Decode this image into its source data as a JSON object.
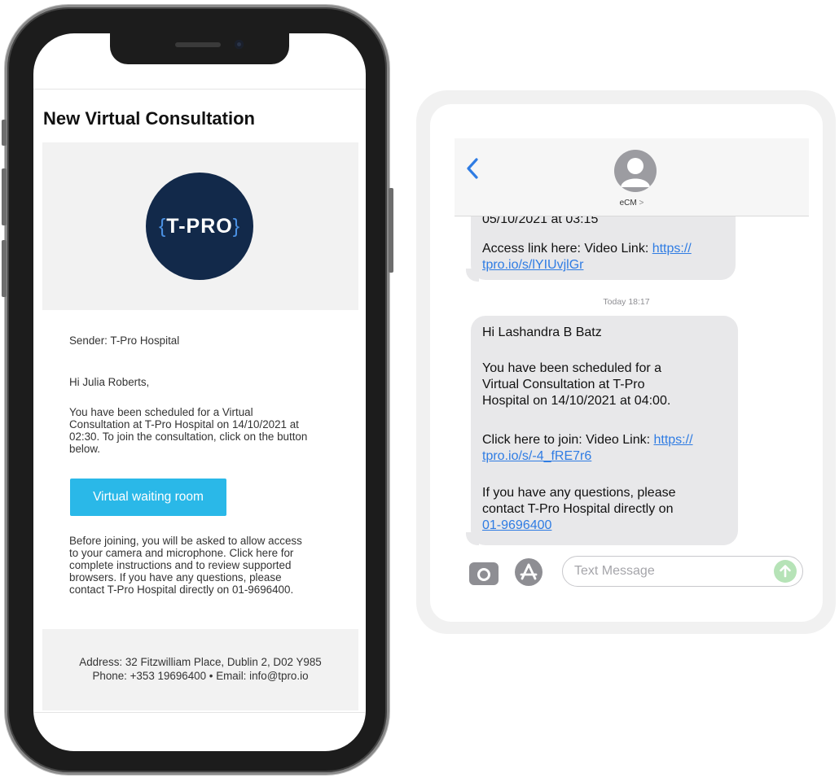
{
  "email": {
    "title": "New Virtual Consultation",
    "logo_text": "T-PRO",
    "sender": "Sender: T-Pro Hospital",
    "greeting": "Hi Julia Roberts,",
    "schedule_lines": [
      "You have been scheduled for a Virtual",
      "Consultation at T-Pro Hospital on 14/10/2021 at",
      "02:30. To join the consultation, click on the button",
      "below."
    ],
    "button_label": "Virtual waiting room",
    "info_lines": [
      "Before joining, you will be asked to allow access",
      "to your camera and microphone. Click here for",
      "complete instructions and to review supported",
      "browsers. If you have any questions, please",
      "contact T-Pro Hospital directly on 01-9696400."
    ],
    "footer_address": "Address: 32 Fitzwilliam Place, Dublin 2, D02 Y985",
    "footer_contact": "Phone: +353 19696400 • Email: info@tpro.io",
    "colors": {
      "button": "#2ab8e8",
      "logo_bg": "#12294a",
      "logo_bracket": "#4a90e2"
    }
  },
  "sms": {
    "back_icon": "chevron-left-icon",
    "contact_name": "eCM",
    "contact_chevron": ">",
    "previous_message": {
      "partial_line": "05/10/2021 at 03:15",
      "link_prefix": "Access link here: Video Link: ",
      "link_line1": "https://",
      "link_line2": "tpro.io/s/lYIUvjlGr"
    },
    "timestamp": "Today 18:17",
    "latest_message": {
      "greeting": "Hi Lashandra B Batz",
      "schedule_lines": [
        "You have been scheduled for a",
        "Virtual Consultation at T-Pro",
        "Hospital on 14/10/2021 at 04:00."
      ],
      "link_prefix": "Click here to join: Video Link: ",
      "link_line1": "https://",
      "link_line2": "tpro.io/s/-4_fRE7r6",
      "question_lines": [
        "If you have any questions, please",
        "contact T-Pro Hospital directly on"
      ],
      "phone_link": "01-9696400"
    },
    "input_placeholder": "Text Message",
    "colors": {
      "link": "#2f7ce3",
      "bubble": "#e8e8ea",
      "send": "#b6e3b7"
    }
  }
}
